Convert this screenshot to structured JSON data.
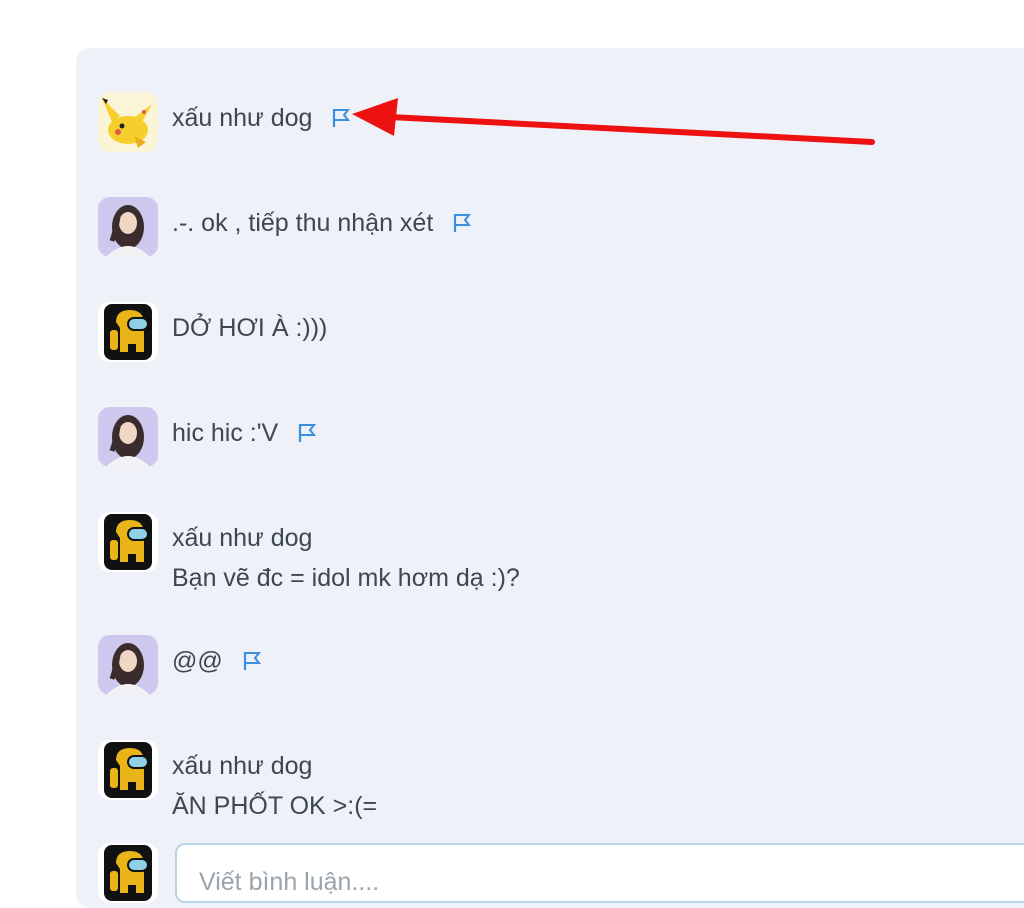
{
  "comments": [
    {
      "avatar": "pikachu-avatar",
      "text": "xấu như dog",
      "flag": true
    },
    {
      "avatar": "girl-avatar",
      "text": ".-. ok , tiếp thu nhận xét",
      "flag": true
    },
    {
      "avatar": "amongus-avatar",
      "text": "DỞ HƠI À :)))",
      "flag": false
    },
    {
      "avatar": "girl-avatar",
      "text": "hic hic :'V",
      "flag": true
    },
    {
      "avatar": "amongus-avatar",
      "quoted": "xấu như dog",
      "text": "Bạn vẽ đc = idol mk hơm dạ :)?",
      "flag": false
    },
    {
      "avatar": "girl-avatar",
      "text": "@@",
      "flag": true
    },
    {
      "avatar": "amongus-avatar",
      "quoted": "xấu như dog",
      "text": "ĂN PHỐT OK >:(=",
      "flag": false
    }
  ],
  "comment_input": {
    "placeholder": "Viết bình luận...."
  },
  "colors": {
    "flag": "#3b8fe0",
    "arrow": "#ee1111",
    "panel": "#eef1f8"
  },
  "icons": [
    "flag-icon"
  ]
}
